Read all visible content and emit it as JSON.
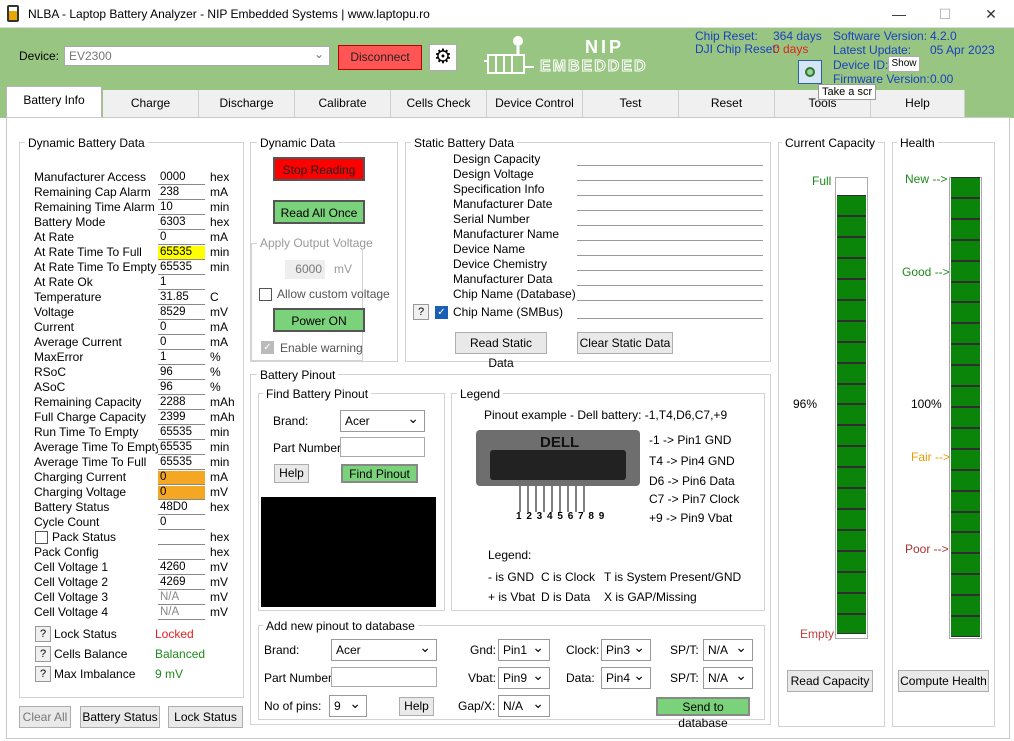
{
  "window": {
    "title": "NLBA - Laptop Battery Analyzer - NIP Embedded Systems | www.laptopu.ro",
    "minimize": "—",
    "maximize": "☐",
    "close": "✕"
  },
  "header": {
    "device_label": "Device:",
    "device_value": "EV2300",
    "disconnect_label": "Disconnect",
    "logo_top": "NIP",
    "logo_bottom": "EMBEDDED",
    "chip_reset_label": "Chip Reset:",
    "chip_reset_value": "364 days",
    "dji_chip_reset_label": "DJI Chip Reset:",
    "dji_chip_reset_value": "0 days",
    "software_version_label": "Software Version:",
    "software_version_value": "4.2.0",
    "latest_update_label": "Latest Update:",
    "latest_update_value": "05 Apr 2023",
    "device_id_label": "Device ID:",
    "show_label": "Show",
    "firmware_version_label": "Firmware Version:",
    "firmware_version_value": "0.00",
    "tooltip": "Take a scr",
    "accent_red": "#e02020",
    "accent_green": "#98c682"
  },
  "tabs": [
    "Battery Info",
    "Charge",
    "Discharge",
    "Calibrate",
    "Cells Check",
    "Device Control",
    "Test",
    "Reset",
    "Tools",
    "Help"
  ],
  "dynamic_battery": {
    "title": "Dynamic Battery Data",
    "rows": [
      {
        "label": "Manufacturer Access",
        "value": "0000",
        "unit": "hex",
        "hl": ""
      },
      {
        "label": "Remaining Cap Alarm",
        "value": "238",
        "unit": "mA",
        "hl": ""
      },
      {
        "label": "Remaining Time Alarm",
        "value": "10",
        "unit": "min",
        "hl": ""
      },
      {
        "label": "Battery Mode",
        "value": "6303",
        "unit": "hex",
        "hl": ""
      },
      {
        "label": "At Rate",
        "value": "0",
        "unit": "mA",
        "hl": ""
      },
      {
        "label": "At Rate Time To Full",
        "value": "65535",
        "unit": "min",
        "hl": "yellow"
      },
      {
        "label": "At Rate Time To Empty",
        "value": "65535",
        "unit": "min",
        "hl": ""
      },
      {
        "label": "At Rate Ok",
        "value": "1",
        "unit": "",
        "hl": ""
      },
      {
        "label": "Temperature",
        "value": "31.85",
        "unit": "C",
        "hl": ""
      },
      {
        "label": "Voltage",
        "value": "8529",
        "unit": "mV",
        "hl": ""
      },
      {
        "label": "Current",
        "value": "0",
        "unit": "mA",
        "hl": ""
      },
      {
        "label": "Average Current",
        "value": "0",
        "unit": "mA",
        "hl": ""
      },
      {
        "label": "MaxError",
        "value": "1",
        "unit": "%",
        "hl": ""
      },
      {
        "label": "RSoC",
        "value": "96",
        "unit": "%",
        "hl": ""
      },
      {
        "label": "ASoC",
        "value": "96",
        "unit": "%",
        "hl": ""
      },
      {
        "label": "Remaining Capacity",
        "value": "2288",
        "unit": "mAh",
        "hl": ""
      },
      {
        "label": "Full Charge Capacity",
        "value": "2399",
        "unit": "mAh",
        "hl": ""
      },
      {
        "label": "Run Time To Empty",
        "value": "65535",
        "unit": "min",
        "hl": ""
      },
      {
        "label": "Average Time To Empty",
        "value": "65535",
        "unit": "min",
        "hl": ""
      },
      {
        "label": "Average Time To Full",
        "value": "65535",
        "unit": "min",
        "hl": ""
      },
      {
        "label": "Charging Current",
        "value": "0",
        "unit": "mA",
        "hl": "orange"
      },
      {
        "label": "Charging Voltage",
        "value": "0",
        "unit": "mV",
        "hl": "orange"
      },
      {
        "label": "Battery Status",
        "value": "48D0",
        "unit": "hex",
        "hl": ""
      },
      {
        "label": "Cycle Count",
        "value": "0",
        "unit": "",
        "hl": ""
      },
      {
        "label": "Pack Status",
        "value": "",
        "unit": "hex",
        "hl": ""
      },
      {
        "label": "Pack Config",
        "value": "",
        "unit": "hex",
        "hl": ""
      },
      {
        "label": "Cell Voltage 1",
        "value": "4260",
        "unit": "mV",
        "hl": ""
      },
      {
        "label": "Cell Voltage 2",
        "value": "4269",
        "unit": "mV",
        "hl": ""
      },
      {
        "label": "Cell Voltage 3",
        "value": "N/A",
        "unit": "mV",
        "hl": ""
      },
      {
        "label": "Cell Voltage 4",
        "value": "N/A",
        "unit": "mV",
        "hl": ""
      }
    ],
    "lock_status_label": "Lock Status",
    "lock_status_value": "Locked",
    "cells_balanced_label": "Cells Balance",
    "cells_balanced_value": "Balanced",
    "max_imbalance_label": "Max Imbalance",
    "max_imbalance_value": "9 mV",
    "q": "?"
  },
  "bottom_buttons": {
    "clear_all": "Clear All",
    "battery_status": "Battery Status",
    "lock_status": "Lock Status"
  },
  "dynamic_data": {
    "title": "Dynamic Data",
    "stop_reading": "Stop Reading",
    "read_all_once": "Read All Once",
    "apply_output_voltage": "Apply Output Voltage",
    "voltage_value": "6000",
    "voltage_unit": "mV",
    "allow_custom_voltage": "Allow custom voltage",
    "power_on": "Power ON",
    "enable_warning": "Enable warning"
  },
  "static_battery": {
    "title": "Static Battery Data",
    "rows": [
      "Design Capacity",
      "Design Voltage",
      "Specification Info",
      "Manufacturer Date",
      "Serial Number",
      "Manufacturer Name",
      "Device Name",
      "Device Chemistry",
      "Manufacturer Data",
      "Chip Name (Database)",
      "Chip Name (SMBus)"
    ],
    "read_static": "Read Static Data",
    "clear_static": "Clear Static Data",
    "q": "?"
  },
  "current_capacity": {
    "title": "Current Capacity",
    "full": "Full",
    "percent_text": "96%",
    "empty": "Empty",
    "button": "Read Capacity",
    "level": 0.96
  },
  "health": {
    "title": "Health",
    "new": "New -->",
    "good": "Good -->",
    "percent_text": "100%",
    "fair": "Fair -->",
    "poor": "Poor -->",
    "button": "Compute Health",
    "level": 1.0
  },
  "pinout": {
    "title": "Battery Pinout",
    "find_title": "Find Battery Pinout",
    "brand_label": "Brand:",
    "brand_value": "Acer",
    "part_label": "Part Number:",
    "part_value": "",
    "help": "Help",
    "find": "Find Pinout",
    "legend_title": "Legend",
    "example": "Pinout example - Dell battery:  -1,T4,D6,C7,+9",
    "dell": "DELL",
    "pin_numbers": "1 2 3 4 5 6 7 8 9",
    "map": [
      "-1 -> Pin1 GND",
      "T4 -> Pin4 GND",
      "D6 -> Pin6 Data",
      "C7 -> Pin7 Clock",
      "+9 -> Pin9 Vbat"
    ],
    "legend_label": "Legend:",
    "legend_rows": [
      [
        "- is GND",
        "C is Clock",
        "T is System Present/GND"
      ],
      [
        "+ is Vbat",
        "D is Data",
        "X is GAP/Missing"
      ]
    ]
  },
  "add_pinout": {
    "title": "Add new pinout to database",
    "brand_label": "Brand:",
    "brand_value": "Acer",
    "part_label": "Part Number:",
    "part_value": "",
    "pins_label": "No of pins:",
    "pins_value": "9",
    "help": "Help",
    "gnd_label": "Gnd:",
    "gnd_value": "Pin1",
    "vbat_label": "Vbat:",
    "vbat_value": "Pin9",
    "gapx_label": "Gap/X:",
    "gapx_value": "N/A",
    "clock_label": "Clock:",
    "clock_value": "Pin3",
    "data_label": "Data:",
    "data_value": "Pin4",
    "spt1_label": "SP/T:",
    "spt1_value": "N/A",
    "spt2_label": "SP/T:",
    "spt2_value": "N/A",
    "send": "Send to database"
  }
}
